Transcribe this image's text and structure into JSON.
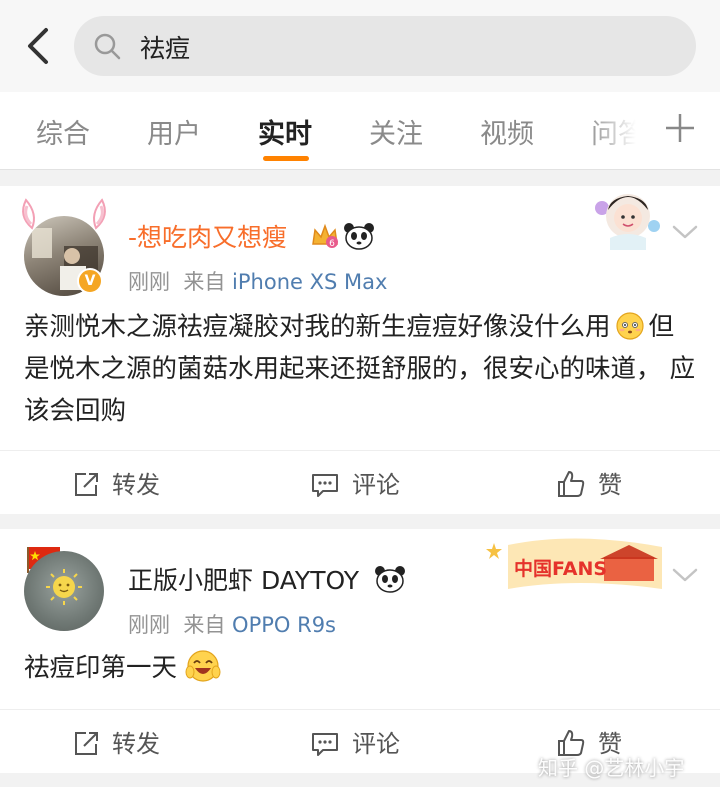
{
  "search": {
    "query": "祛痘"
  },
  "tabs": [
    {
      "label": "综合"
    },
    {
      "label": "用户"
    },
    {
      "label": "实时"
    },
    {
      "label": "关注"
    },
    {
      "label": "视频"
    },
    {
      "label": "问答"
    }
  ],
  "active_tab": "实时",
  "posts": [
    {
      "username": "-想吃肉又想瘦",
      "time": "刚刚",
      "source_prefix": "来自",
      "source": "iPhone XS Max",
      "text_parts": [
        "亲测悦木之源祛痘凝胶对我的新生痘痘好像没什么用",
        "但是悦木之源的菌菇水用起来还挺舒服的，很安心的味道， 应该会回购"
      ],
      "badge_icons": [
        "crown-vip-icon",
        "panda-icon"
      ],
      "inline_emoji": "embarrassed-emoji",
      "avatar_badge": "V",
      "actions": {
        "repost": "转发",
        "comment": "评论",
        "like": "赞"
      }
    },
    {
      "username": "正版小肥虾 DAYTOY",
      "time": "刚刚",
      "source_prefix": "来自",
      "source": "OPPO R9s",
      "text_parts": [
        "祛痘印第一天"
      ],
      "badge_icons": [
        "panda-icon"
      ],
      "inline_emoji": "laughing-emoji",
      "deco_badge": "中国FANS",
      "actions": {
        "repost": "转发",
        "comment": "评论",
        "like": "赞"
      }
    }
  ],
  "watermark": "知乎 @艺林小宇",
  "colors": {
    "accent": "#ff8200",
    "vip_name": "#f86e2b",
    "source_link": "#507daf",
    "meta": "#939393"
  }
}
